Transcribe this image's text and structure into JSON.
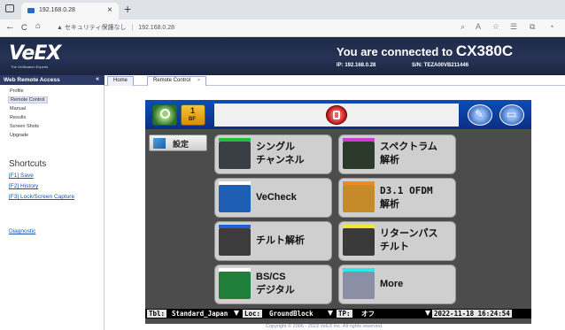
{
  "browser": {
    "tab_title": "192.168.0.28",
    "tab_close": "×",
    "new_tab": "+",
    "back": "←",
    "refresh": "C",
    "home": "⌂",
    "security_label": "▲ セキュリティ保護なし",
    "separator": "|",
    "url": "192.168.0.28"
  },
  "header": {
    "logo_text": "VeEX",
    "logo_tagline": "The Verification Experts",
    "connected_prefix": "You are connected to",
    "device_name": "CX380C",
    "ip_line": "IP: 192.168.0.28",
    "sn_line": "S/N: TEZA00VB211446"
  },
  "sidebar": {
    "title": "Web Remote Access",
    "collapse_glyph": "«",
    "items": [
      {
        "label": "Profile"
      },
      {
        "label": "Remote Control"
      },
      {
        "label": "Manual"
      },
      {
        "label": "Results"
      },
      {
        "label": "Screen Shots"
      },
      {
        "label": "Upgrade"
      }
    ],
    "shortcuts_title": "Shortcuts",
    "shortcuts": [
      {
        "label": "[F1] Save"
      },
      {
        "label": "[F2] History"
      },
      {
        "label": "[F3] Lock/Screen Capture"
      }
    ],
    "diagnostic": "Diagnostic"
  },
  "content_tabs": {
    "home": "Home",
    "remote": "Remote Control",
    "remote_close": "×"
  },
  "panel": {
    "battery_number": "1",
    "battery_label": "BF",
    "settings_label": "設定",
    "apps": [
      {
        "line1": "シングル",
        "line2": "チャンネル",
        "bar": "#1ec23b",
        "icon": "#3a3f46"
      },
      {
        "line1": "スペクトラム",
        "line2": "解析",
        "bar": "#d43bd4",
        "icon": "#2c3a2c"
      },
      {
        "line1": "VeCheck",
        "line2": "",
        "bar": "#ffffff",
        "icon": "#1f5fb3"
      },
      {
        "line1": "D3.1 OFDM",
        "line2": "解析",
        "bar": "#f08a1a",
        "icon": "#c78a2a"
      },
      {
        "line1": "チルト解析",
        "line2": "",
        "bar": "#2060d8",
        "icon": "#3c3c3c"
      },
      {
        "line1": "リターンパス",
        "line2": "チルト",
        "bar": "#f5e533",
        "icon": "#3a3a3a"
      },
      {
        "line1": "BS/CS",
        "line2": "デジタル",
        "bar": "#ffffff",
        "icon": "#1f7f3a"
      },
      {
        "line1": "More",
        "line2": "",
        "bar": "#2ee6f0",
        "icon": "#8b8fa6"
      }
    ]
  },
  "status": {
    "tbl_label": "Tbl:",
    "tbl_value": "Standard_Japan",
    "loc_label": "Loc:",
    "loc_value": "GroundBlock",
    "tp_label": "TP:",
    "tp_value": "オフ",
    "datetime": "2022-11-18  16:24:54"
  },
  "footer": {
    "copyright": "Copyright © 2006 - 2022 VeEX Inc. All rights reserved."
  }
}
